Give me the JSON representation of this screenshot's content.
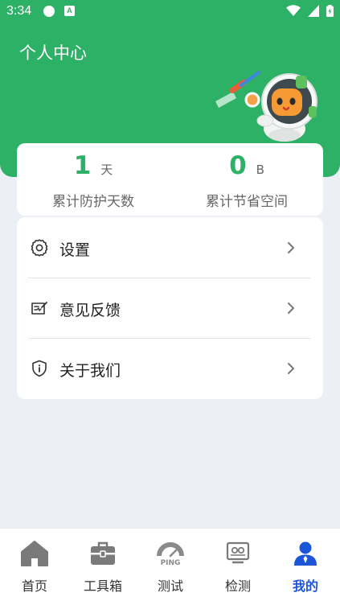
{
  "status_bar": {
    "time": "3:34",
    "notification_letter": "A"
  },
  "header": {
    "title": "个人中心"
  },
  "stats": [
    {
      "value": "1",
      "unit": "天",
      "label": "累计防护天数"
    },
    {
      "value": "0",
      "unit": "B",
      "label": "累计节省空间"
    }
  ],
  "menu": [
    {
      "label": "设置",
      "icon": "gear-icon"
    },
    {
      "label": "意见反馈",
      "icon": "feedback-icon"
    },
    {
      "label": "关于我们",
      "icon": "info-shield-icon"
    }
  ],
  "bottom_nav": [
    {
      "label": "首页",
      "icon": "home-icon",
      "active": false
    },
    {
      "label": "工具箱",
      "icon": "toolbox-icon",
      "active": false
    },
    {
      "label": "测试",
      "icon": "speedometer-icon",
      "icon_text": "PING",
      "active": false
    },
    {
      "label": "检测",
      "icon": "monitor-icon",
      "active": false
    },
    {
      "label": "我的",
      "icon": "profile-icon",
      "active": true
    }
  ],
  "colors": {
    "brand_green": "#2db166",
    "active_blue": "#1d55d8",
    "inactive_icon": "#7a7a7a",
    "page_background": "#eceff5"
  }
}
